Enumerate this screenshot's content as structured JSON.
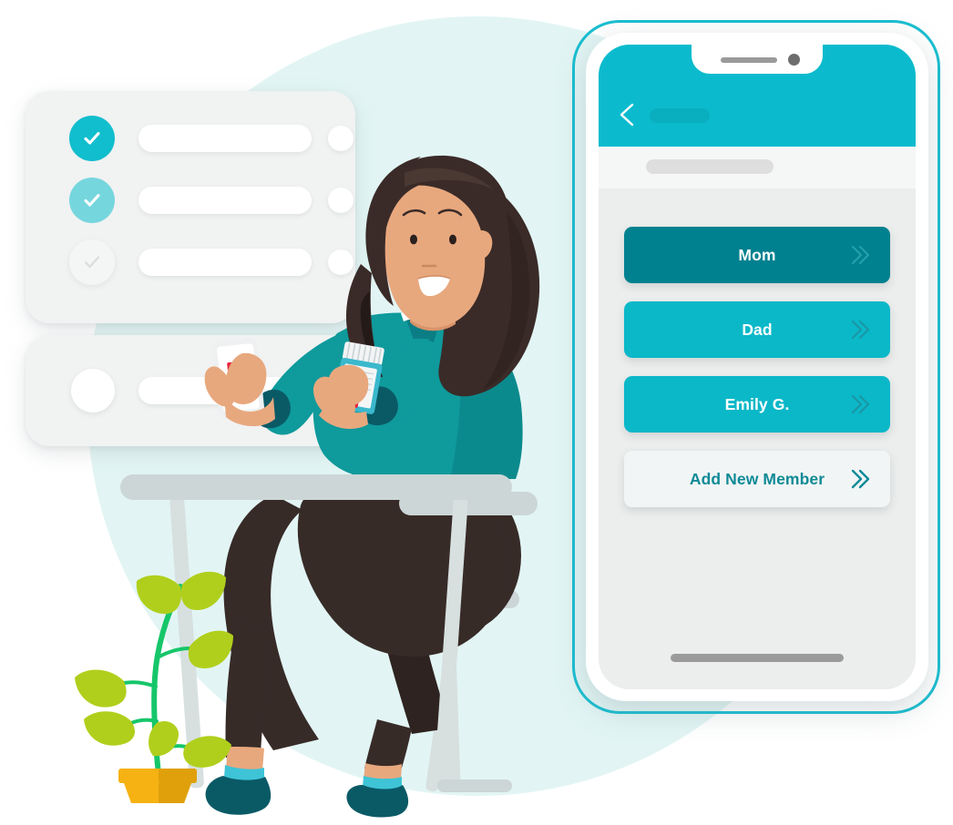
{
  "illustration": {
    "title": "Family members list on mobile app",
    "background_color": "#e2f5f4"
  },
  "checklist_card": {
    "rows": [
      {
        "state": "checked",
        "check_color": "#11bece",
        "check_mark": "check-icon"
      },
      {
        "state": "checked-light",
        "check_color": "#76d6de",
        "check_mark": "check-icon"
      },
      {
        "state": "unchecked",
        "check_color": "#f4f5f5",
        "check_mark": "check-icon"
      }
    ]
  },
  "secondary_card": {
    "avatar_placeholder": "circle-placeholder"
  },
  "scene": {
    "plant_pot_color": "#f5b212",
    "plant_leaf_color": "#b0cf1c",
    "plant_stem_color": "#16c66a",
    "desk_color": "#ccd6d6",
    "chair_color": "#ccd6d6",
    "hair_color": "#3a2b28",
    "skin_color": "#e8a87e",
    "sweater_color": "#118c8f",
    "pants_color": "#372b28",
    "sock_color": "#0a5a66",
    "sock_cuff_color": "#3ec4d6",
    "rx_label": "Rx",
    "rx_color": "#e8253a"
  },
  "phone": {
    "frame_color": "#18bed0",
    "status_bar_color": "#0bbbcd",
    "screen_background": "#eceded",
    "notch": {
      "speaker": "speaker-grille",
      "camera": "front-camera-icon"
    },
    "nav": {
      "back_icon": "chevron-left-icon",
      "title_placeholder": "title-placeholder"
    },
    "search": {
      "placeholder_bar": "search-placeholder"
    },
    "home_indicator": "home-indicator",
    "members": [
      {
        "label": "Mom",
        "bg": "#00818f",
        "text_color": "#ffffff",
        "chevron_color": "#24a0ab",
        "selected": true
      },
      {
        "label": "Dad",
        "bg": "#0ab8c8",
        "text_color": "#ffffff",
        "chevron_color": "#1b97a5",
        "selected": false
      },
      {
        "label": "Emily G.",
        "bg": "#0ab8c8",
        "text_color": "#ffffff",
        "chevron_color": "#1b97a5",
        "selected": false
      }
    ],
    "add_member": {
      "label": "Add New Member",
      "bg": "#f2f5f5",
      "text_color": "#0e8a97",
      "chevron_color": "#0e8a97"
    }
  }
}
